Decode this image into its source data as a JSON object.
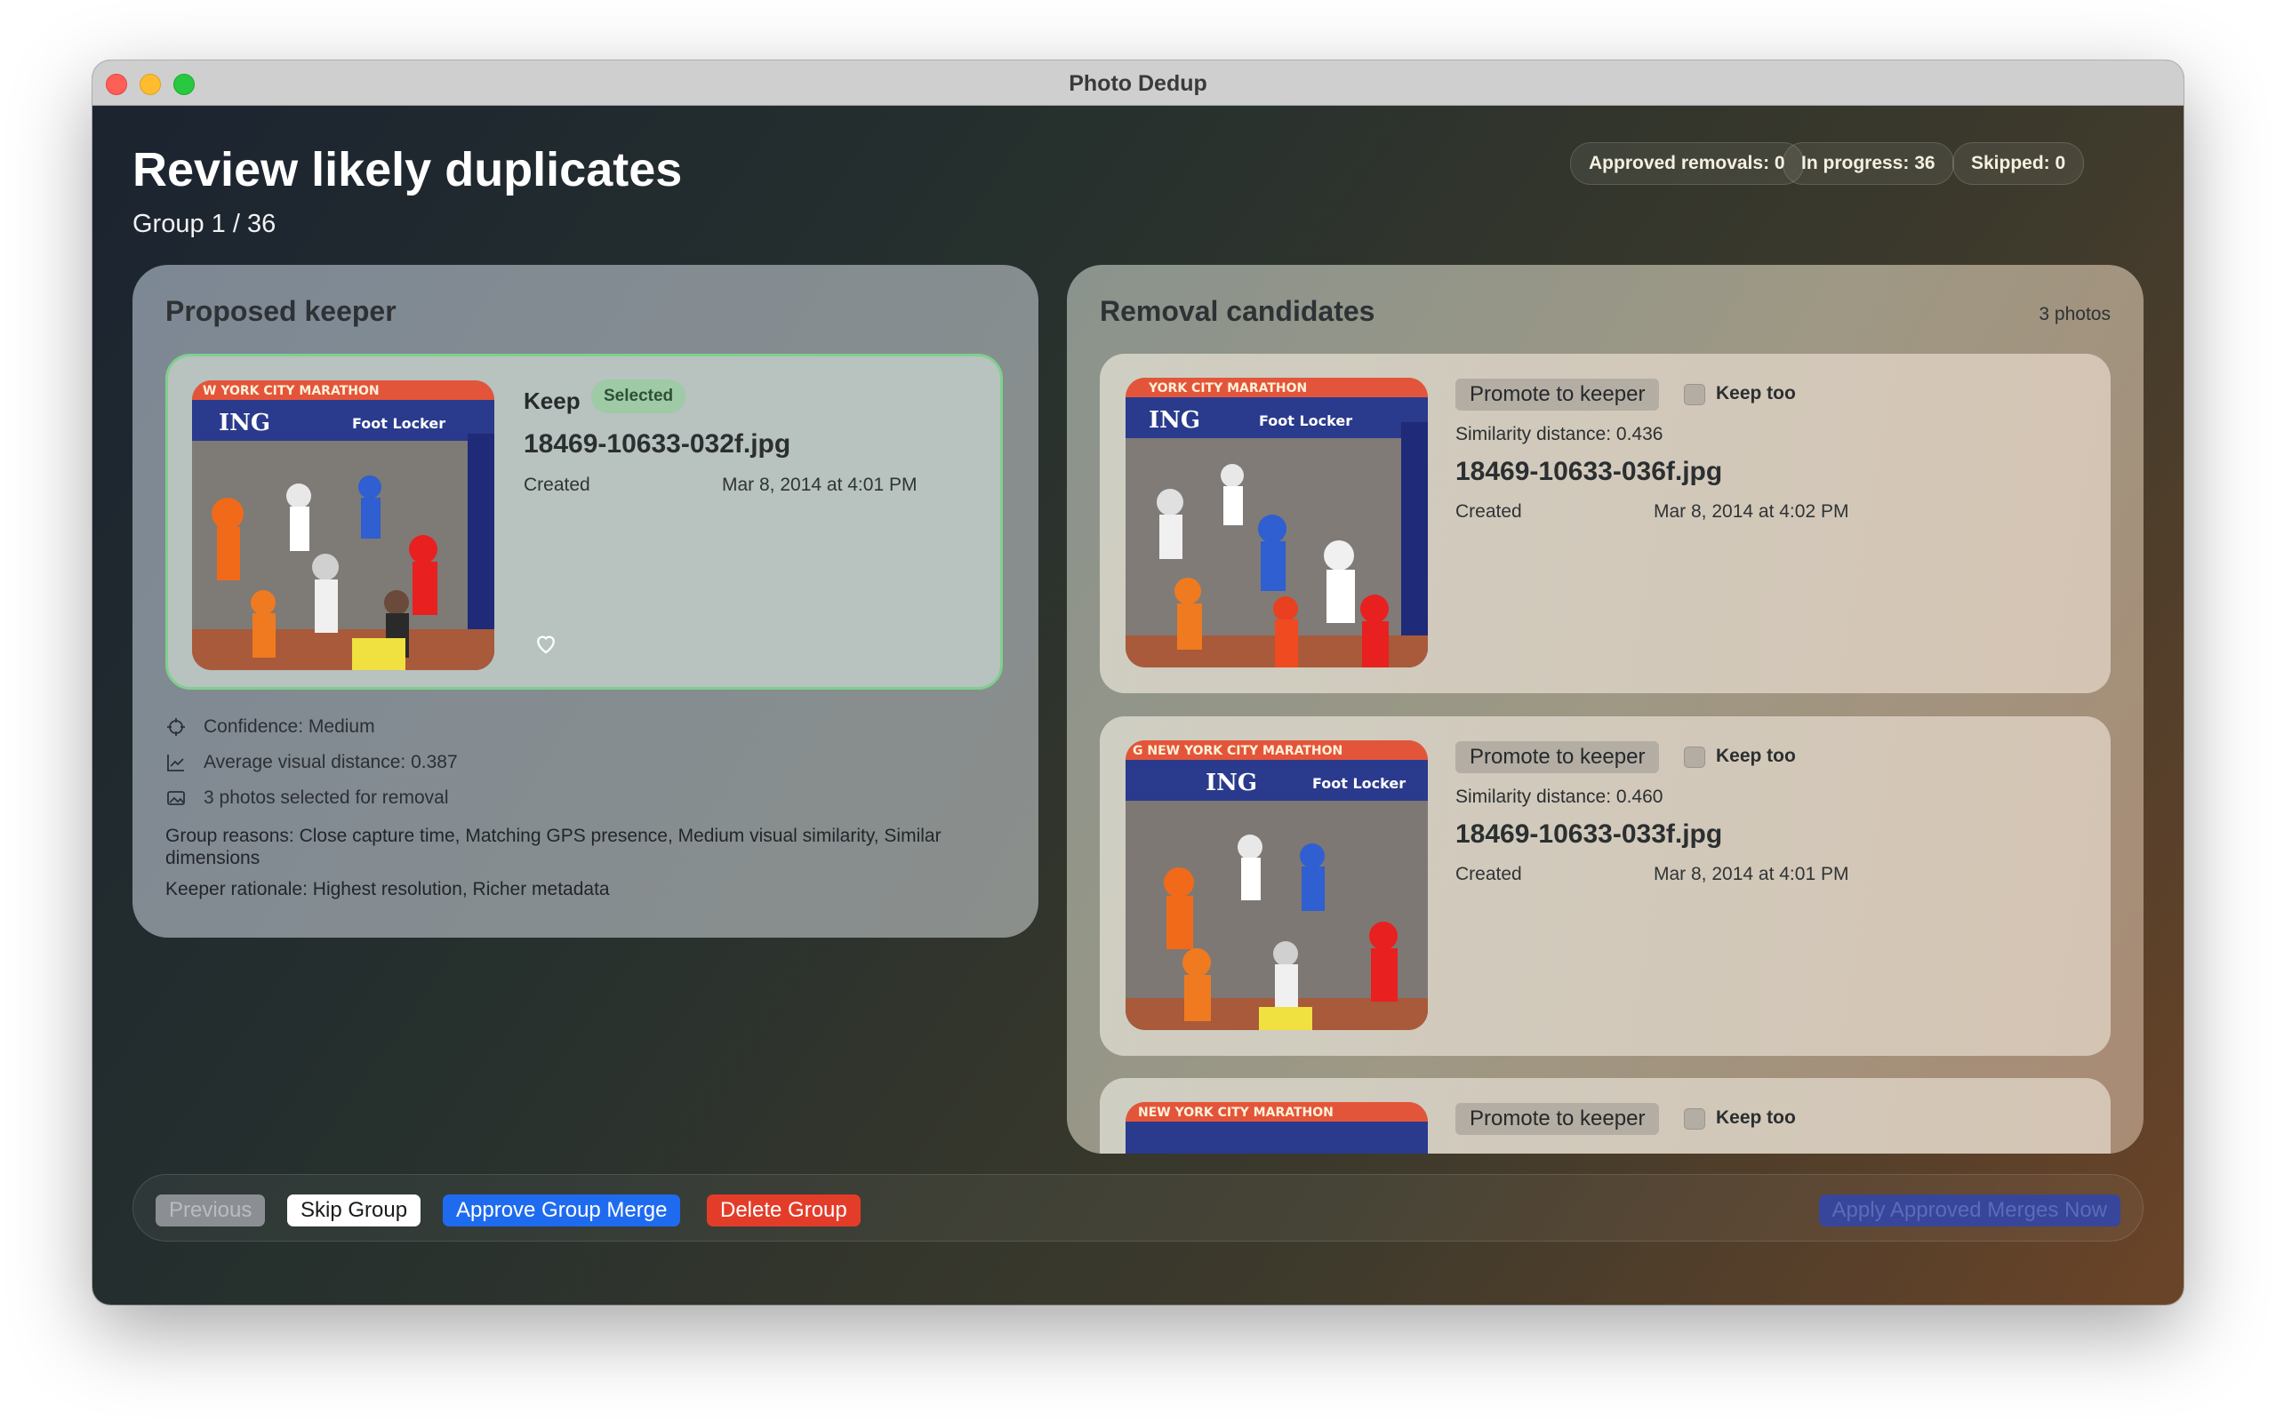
{
  "window": {
    "title": "Photo Dedup"
  },
  "header": {
    "title": "Review likely duplicates",
    "subtitle": "Group 1 / 36",
    "stats": {
      "approved": "Approved removals: 0",
      "in_progress": "In progress: 36",
      "skipped": "Skipped: 0"
    }
  },
  "keeper": {
    "panel_title": "Proposed keeper",
    "keep_label": "Keep",
    "badge": "Selected",
    "filename": "18469-10633-032f.jpg",
    "created_label": "Created",
    "created_value": "Mar 8, 2014 at 4:01 PM",
    "thumb_banner": "W YORK CITY MARATHON",
    "thumb_sponsor_1": "ING",
    "thumb_sponsor_2": "Foot Locker",
    "info": {
      "confidence": "Confidence: Medium",
      "avg_distance": "Average visual distance: 0.387",
      "selected_count": "3 photos selected for removal",
      "group_reasons": "Group reasons: Close capture time, Matching GPS presence, Medium visual similarity, Similar dimensions",
      "keeper_rationale": "Keeper rationale: Highest resolution, Richer metadata"
    }
  },
  "candidates": {
    "panel_title": "Removal candidates",
    "count": "3 photos",
    "items": [
      {
        "promote_label": "Promote to keeper",
        "keep_too_label": "Keep too",
        "similarity": "Similarity distance: 0.436",
        "filename": "18469-10633-036f.jpg",
        "created_label": "Created",
        "created_value": "Mar 8, 2014 at 4:02 PM",
        "thumb_banner": "YORK CITY MARATHON",
        "thumb_sponsor_1": "ING",
        "thumb_sponsor_2": "Foot Locker"
      },
      {
        "promote_label": "Promote to keeper",
        "keep_too_label": "Keep too",
        "similarity": "Similarity distance: 0.460",
        "filename": "18469-10633-033f.jpg",
        "created_label": "Created",
        "created_value": "Mar 8, 2014 at 4:01 PM",
        "thumb_banner": "G NEW YORK CITY MARATHON",
        "thumb_sponsor_1": "ING",
        "thumb_sponsor_2": "Foot Locker"
      },
      {
        "promote_label": "Promote to keeper",
        "keep_too_label": "Keep too",
        "thumb_banner": "NEW YORK CITY MARATHON"
      }
    ]
  },
  "actions": {
    "previous": "Previous",
    "skip": "Skip Group",
    "approve": "Approve Group Merge",
    "delete": "Delete Group",
    "apply": "Apply Approved Merges Now"
  },
  "icons": [
    "close-icon",
    "minimize-icon",
    "zoom-icon",
    "heart-icon",
    "confidence-icon",
    "chart-icon",
    "photos-icon"
  ]
}
